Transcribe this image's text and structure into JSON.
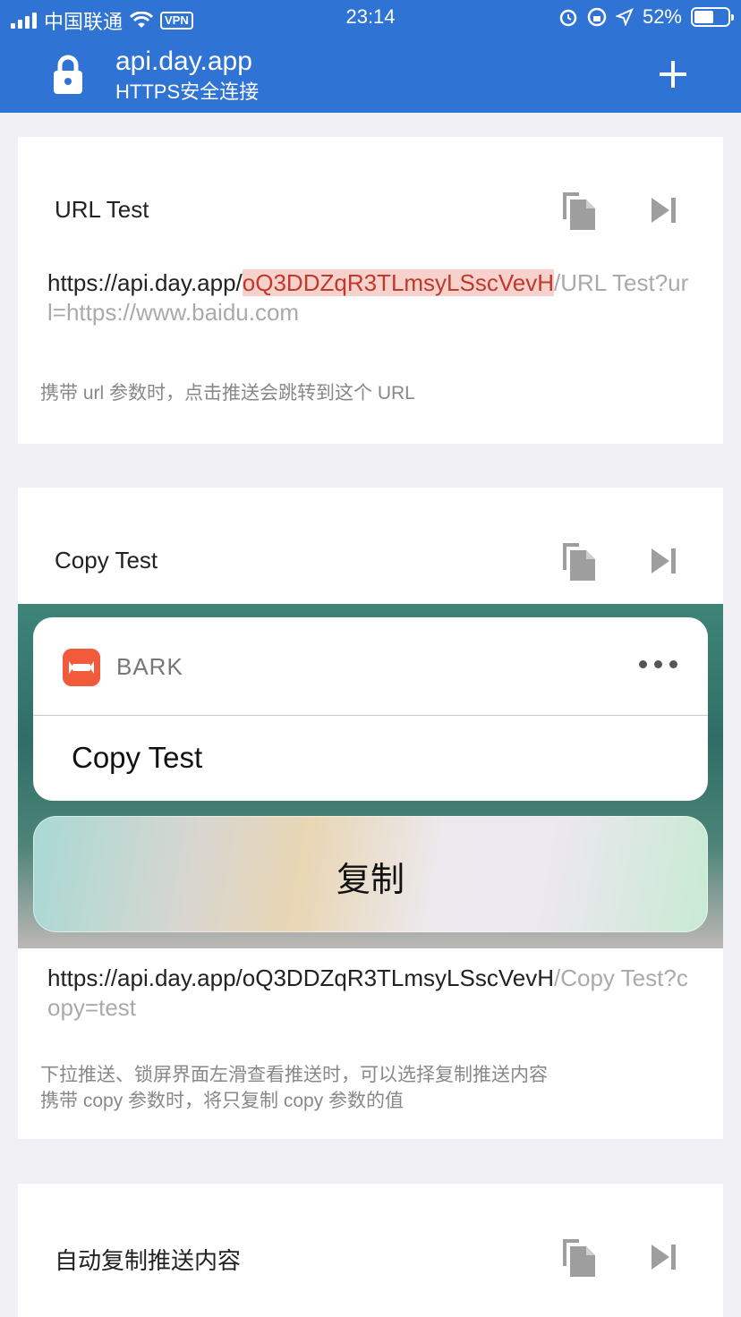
{
  "status_bar": {
    "carrier": "中国联通",
    "vpn": "VPN",
    "time": "23:14",
    "battery": "52%"
  },
  "header": {
    "host": "api.day.app",
    "subtitle": "HTTPS安全连接",
    "lock_icon": "lock-icon",
    "add_icon": "plus-icon",
    "bg_color": "#2f73d4"
  },
  "cards": [
    {
      "title": "URL Test",
      "url_prefix": "https://api.day.app/",
      "url_key": "oQ3DDZqR3TLmsyLSscVevH",
      "url_suffix": "/URL Test?url=https://www.baidu.com",
      "note_lines": [
        "携带 url 参数时，点击推送会跳转到这个 URL"
      ]
    },
    {
      "title": "Copy Test",
      "preview": {
        "app_name": "BARK",
        "message": "Copy Test",
        "action": "复制"
      },
      "url_prefix": "https://api.day.app/oQ3DDZqR3TLmsyLSscVevH",
      "url_suffix": "/Copy Test?copy=test",
      "note_lines": [
        "下拉推送、锁屏界面左滑查看推送时，可以选择复制推送内容",
        "携带 copy 参数时，将只复制 copy 参数的值"
      ]
    },
    {
      "title": "自动复制推送内容"
    }
  ]
}
